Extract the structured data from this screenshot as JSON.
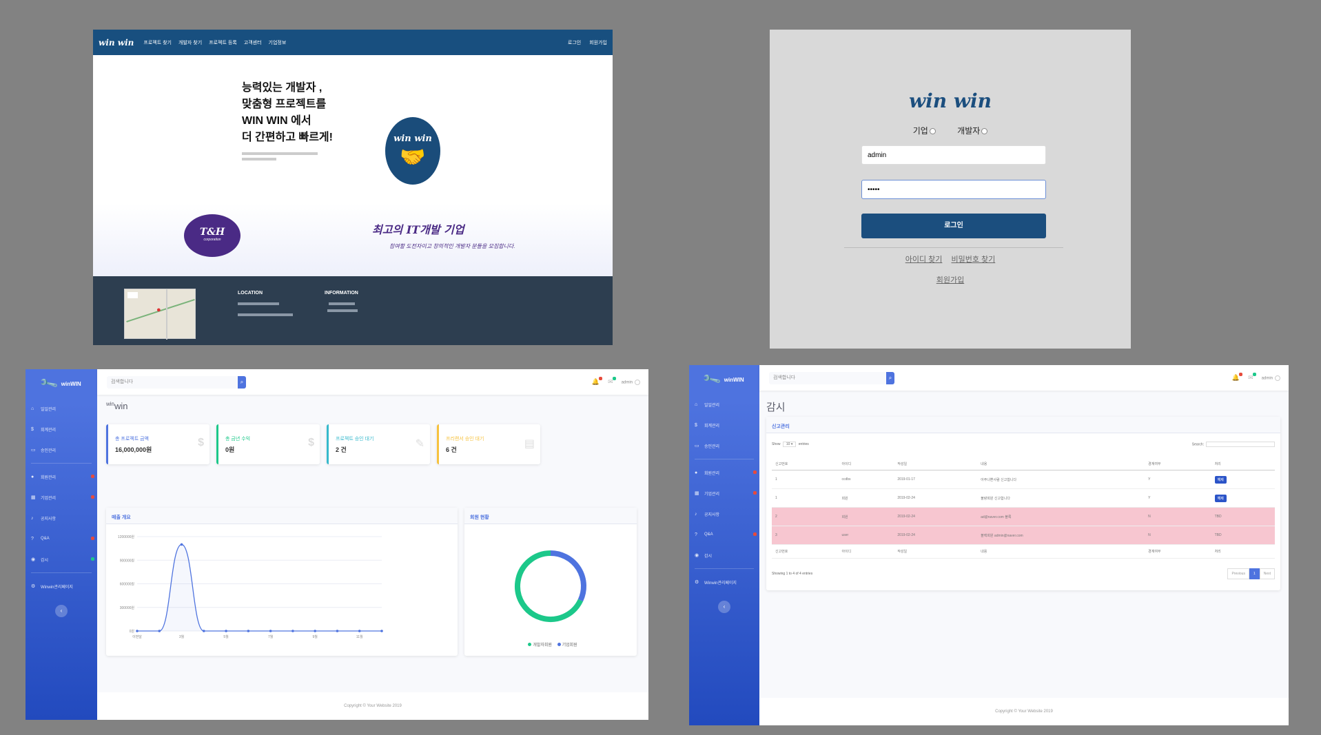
{
  "landing": {
    "logo": "win win",
    "menu": [
      "프로젝트 찾기",
      "개발자 찾기",
      "프로젝트 등록",
      "고객센터",
      "기업정보"
    ],
    "right_links": [
      "로그인",
      "회원가입"
    ],
    "hero_title": [
      "능력있는 개발자 ,",
      "맞춤형 프로젝트를",
      "WIN WIN 에서",
      "더 간편하고 빠르게!"
    ],
    "hero_logo_text": "win win",
    "hero_logo_icon": "handshake-icon",
    "th_logo": "T&H",
    "th_logo_sub": "corporation",
    "band_title": "최고의 IT개발 기업",
    "band_subtitle": "참여할 도전자이고 창의적인 개발자 분들을 모집합니다.",
    "footer": {
      "location_title": "LOCATION",
      "information_title": "INFORMATION"
    }
  },
  "login": {
    "logo": "win win",
    "radio_company": "기업",
    "radio_developer": "개발자",
    "id_value": "admin",
    "pw_value": "•••••",
    "login_button": "로그인",
    "find_id": "아이디 찾기",
    "find_pw": "비밀번호 찾기",
    "join": "회원가입"
  },
  "dashboard": {
    "brand": "winWIN",
    "sidebar": [
      {
        "label": "일일관리",
        "icon": "home-icon"
      },
      {
        "label": "회계관리",
        "icon": "dollar-icon"
      },
      {
        "label": "승인관리",
        "icon": "monitor-icon"
      },
      {
        "label": "회원관리",
        "icon": "user-icon",
        "badge": "#e74a3b"
      },
      {
        "label": "기업관리",
        "icon": "building-icon",
        "badge": "#e74a3b"
      },
      {
        "label": "공지사항",
        "icon": "bell-icon"
      },
      {
        "label": "Q&A",
        "icon": "question-icon",
        "badge": "#e74a3b"
      },
      {
        "label": "감시",
        "icon": "eye-icon",
        "badge": "#1cc88a"
      },
      {
        "label": "Winwin관리페이지",
        "icon": "settings-icon"
      }
    ],
    "search_placeholder": "검색합니다",
    "user": "admin",
    "page_title": "win",
    "page_title_sup": "win",
    "cards": [
      {
        "label": "총 프로젝트 금액",
        "value": "16,000,000원",
        "color": "#4e73df",
        "icon": "$"
      },
      {
        "label": "총 금년 수익",
        "value": "0원",
        "color": "#1cc88a",
        "icon": "$"
      },
      {
        "label": "프로젝트 승인 대기",
        "value": "2 건",
        "color": "#36b9cc",
        "icon": "✎"
      },
      {
        "label": "프리랜서 승인 대기",
        "value": "6 건",
        "color": "#f6c23e",
        "icon": "▤"
      }
    ],
    "line_title": "매출 개요",
    "donut_title": "회원 현황",
    "donut_legend": [
      "개발자회원",
      "기업회원"
    ]
  },
  "chart_data": [
    {
      "type": "line",
      "x": [
        "이번달",
        "2월",
        "3월",
        "4월",
        "5월",
        "6월",
        "7월",
        "8월",
        "9월",
        "10월",
        "11월",
        "12월"
      ],
      "xticks": [
        "이번달",
        "3월",
        "5월",
        "7월",
        "9월",
        "11월"
      ],
      "values": [
        0,
        0,
        1100000,
        0,
        0,
        0,
        0,
        0,
        0,
        0,
        0,
        0
      ],
      "ylim": [
        0,
        1200000
      ],
      "yticks": [
        "0원",
        "300000원",
        "600000원",
        "900000원",
        "1200000원"
      ],
      "color": "#4e73df"
    },
    {
      "type": "pie",
      "labels": [
        "개발자회원",
        "기업회원"
      ],
      "values": [
        68,
        32
      ],
      "colors": [
        "#1cc88a",
        "#4e73df"
      ]
    }
  ],
  "table_page": {
    "brand": "winWIN",
    "search_placeholder": "검색합니다",
    "user": "admin",
    "page_title": "감시",
    "card_title": "신고관리",
    "show_label": "Show",
    "show_value": "10",
    "entries_label": "entries",
    "search_label": "Search:",
    "columns": [
      "신고번호",
      "아이디",
      "작성일",
      "내용",
      "경계여부",
      "처리"
    ],
    "rows": [
      {
        "no": "1",
        "id": "ccdbs",
        "date": "2019-01-17",
        "content": "아주나쁜사람 신고합니다",
        "warn": "Y",
        "action": "해제",
        "flag": false
      },
      {
        "no": "1",
        "id": "회원",
        "date": "2019-02-24",
        "content": "불량회원 신고합니다",
        "warn": "Y",
        "action": "해제",
        "flag": false
      },
      {
        "no": "2",
        "id": "회원",
        "date": "2019-02-24",
        "content": "ad@naver.com 블록",
        "warn": "N",
        "action": "TBD",
        "flag": true
      },
      {
        "no": "3",
        "id": "user",
        "date": "2019-02-24",
        "content": "블랙회원 admin@naver.com",
        "warn": "N",
        "action": "TBD",
        "flag": true
      }
    ],
    "info": "Showing 1 to 4 of 4 entries",
    "prev": "Previous",
    "page": "1",
    "next": "Next",
    "footer": "Copyright © Your Website 2019"
  }
}
